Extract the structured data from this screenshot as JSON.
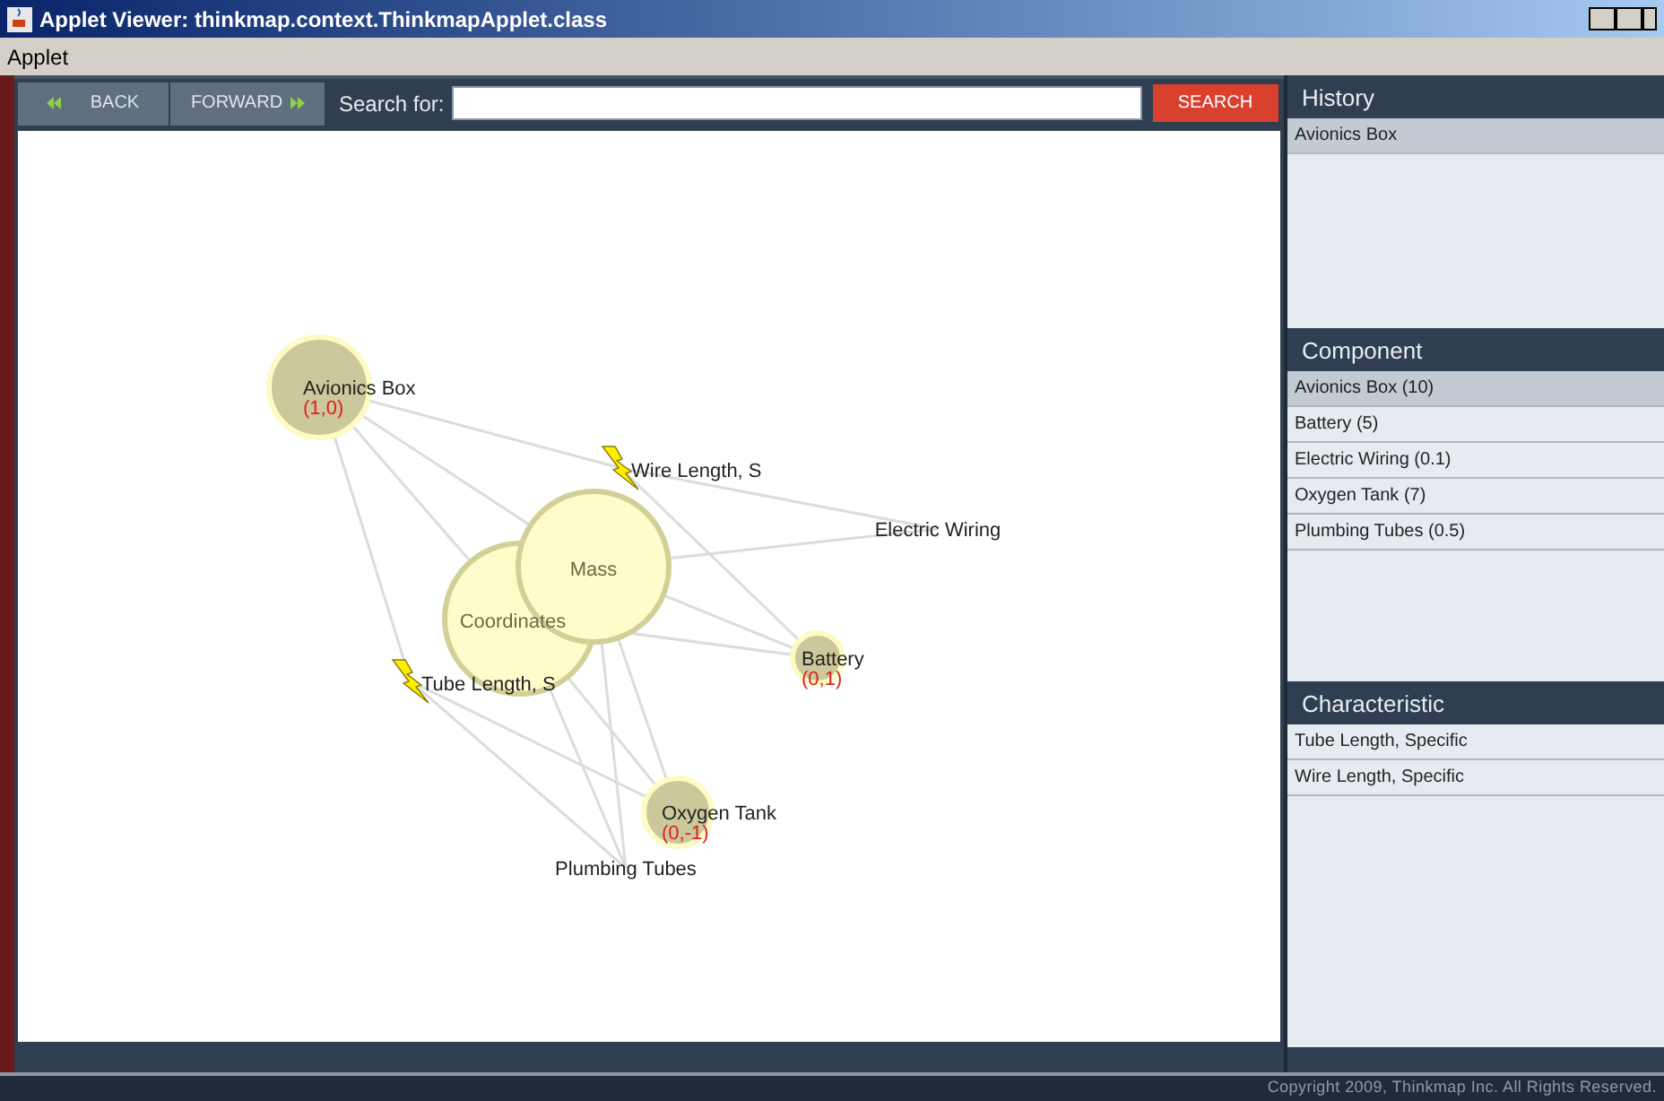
{
  "window": {
    "title": "Applet Viewer: thinkmap.context.ThinkmapApplet.class"
  },
  "menu": [
    "Applet"
  ],
  "toolbar": {
    "back": "BACK",
    "forward": "FORWARD",
    "search_label": "Search for:",
    "search_button": "SEARCH"
  },
  "graph": {
    "nodes": [
      {
        "kind": "component",
        "label": "Avionics Box",
        "coords": "(1,0)"
      },
      {
        "kind": "characteristic",
        "label": "Wire Length, S"
      },
      {
        "kind": "plain",
        "label": "Electric Wiring"
      },
      {
        "kind": "group",
        "label": "Mass"
      },
      {
        "kind": "group",
        "label": "Coordinates"
      },
      {
        "kind": "characteristic",
        "label": "Tube Length, S"
      },
      {
        "kind": "component",
        "label": "Battery",
        "coords": "(0,1)"
      },
      {
        "kind": "component",
        "label": "Oxygen Tank",
        "coords": "(0,-1)"
      },
      {
        "kind": "plain",
        "label": "Plumbing Tubes"
      }
    ]
  },
  "panels": [
    {
      "title": "History",
      "items": [
        {
          "label": "Avionics Box",
          "selected": true
        }
      ]
    },
    {
      "title": "Component",
      "items": [
        {
          "label": "Avionics Box (10)",
          "selected": true
        },
        {
          "label": "Battery (5)",
          "selected": false
        },
        {
          "label": "Electric Wiring (0.1)",
          "selected": false
        },
        {
          "label": "Oxygen Tank (7)",
          "selected": false
        },
        {
          "label": "Plumbing Tubes (0.5)",
          "selected": false
        }
      ]
    },
    {
      "title": "Characteristic",
      "items": [
        {
          "label": "Tube Length, Specific",
          "selected": false
        },
        {
          "label": "Wire Length, Specific",
          "selected": false
        }
      ]
    }
  ],
  "footer": "Copyright 2009, Thinkmap Inc. All Rights Reserved."
}
